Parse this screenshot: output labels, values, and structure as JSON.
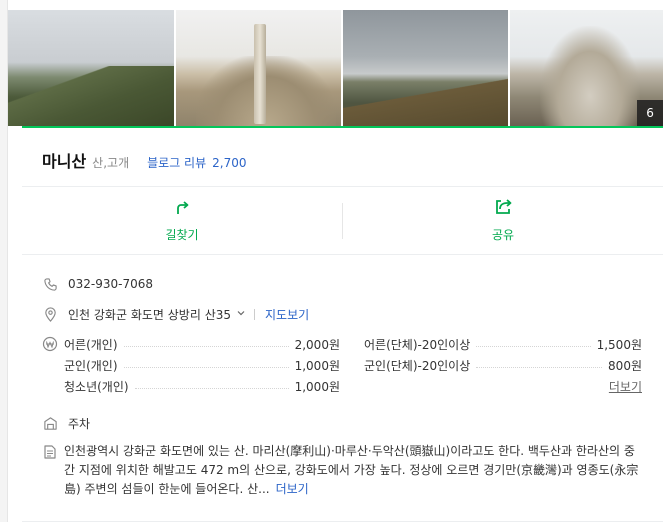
{
  "photos": {
    "count_badge": "6",
    "items": [
      {
        "name": "photo-mountain-ridge"
      },
      {
        "name": "photo-summit-marker"
      },
      {
        "name": "photo-valley-view"
      },
      {
        "name": "photo-rocky-peak"
      }
    ]
  },
  "place": {
    "title": "마니산",
    "category": "산,고개",
    "blog_label": "블로그 리뷰",
    "blog_count": "2,700"
  },
  "actions": {
    "directions_label": "길찾기",
    "share_label": "공유"
  },
  "info": {
    "phone": "032-930-7068",
    "address": "인천 강화군 화도면 상방리 산35",
    "map_link": "지도보기",
    "parking": "주차"
  },
  "fees": {
    "left": [
      {
        "label": "어른(개인)",
        "value": "2,000원"
      },
      {
        "label": "군인(개인)",
        "value": "1,000원"
      },
      {
        "label": "청소년(개인)",
        "value": "1,000원"
      }
    ],
    "right": [
      {
        "label": "어른(단체)-20인이상",
        "value": "1,500원"
      },
      {
        "label": "군인(단체)-20인이상",
        "value": "800원"
      }
    ],
    "more_label": "더보기"
  },
  "description": {
    "text": "인천광역시 강화군 화도면에 있는 산. 마리산(摩利山)·마루산·두악산(頭嶽山)이라고도 한다. 백두산과 한라산의 중간 지점에 위치한 해발고도 472 m의 산으로, 강화도에서 가장 높다. 정상에 오르면 경기만(京畿灣)과 영종도(永宗島) 주변의 섬들이 한눈에 들어온다. 산...",
    "more_label": "더보기"
  },
  "colors": {
    "accent": "#03c75a",
    "action_text": "#03a94f",
    "link": "#2c64c8"
  }
}
